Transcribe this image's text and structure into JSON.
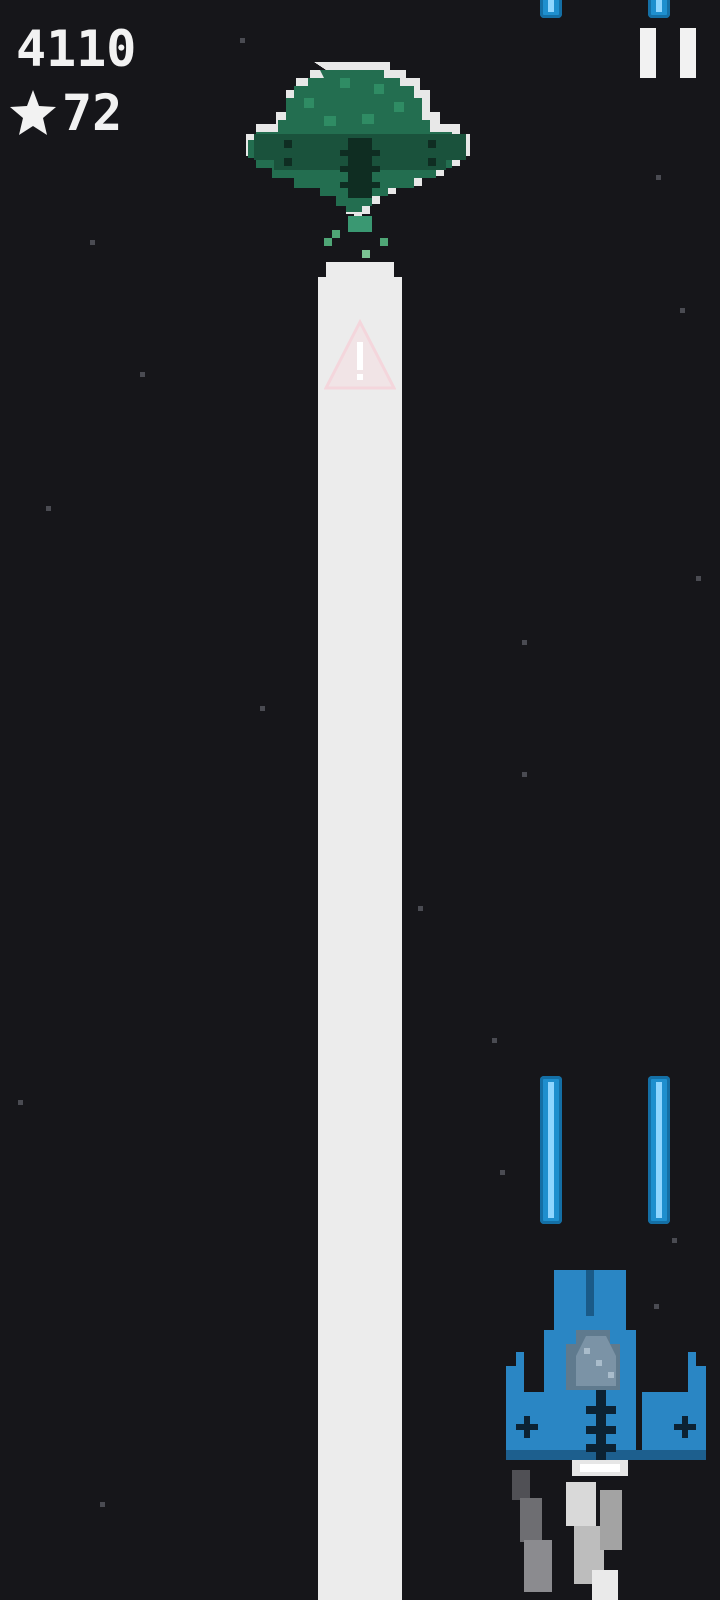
{
  "hud": {
    "score": "4110",
    "stars": "72",
    "star_icon": "star-icon",
    "pause_icon": "pause-icon"
  },
  "sprites": {
    "enemy": "enemy-ufo",
    "player": "player-ship",
    "beam": "laser-beam",
    "warning": "warning-icon",
    "bolt": "laser-bolt"
  },
  "colors": {
    "background": "#16161a",
    "hud_text": "#f2f2f2",
    "beam": "#ececec",
    "enemy_green": "#1f6b4e",
    "player_blue": "#2a86c4",
    "bolt_blue": "#1e8fce"
  }
}
